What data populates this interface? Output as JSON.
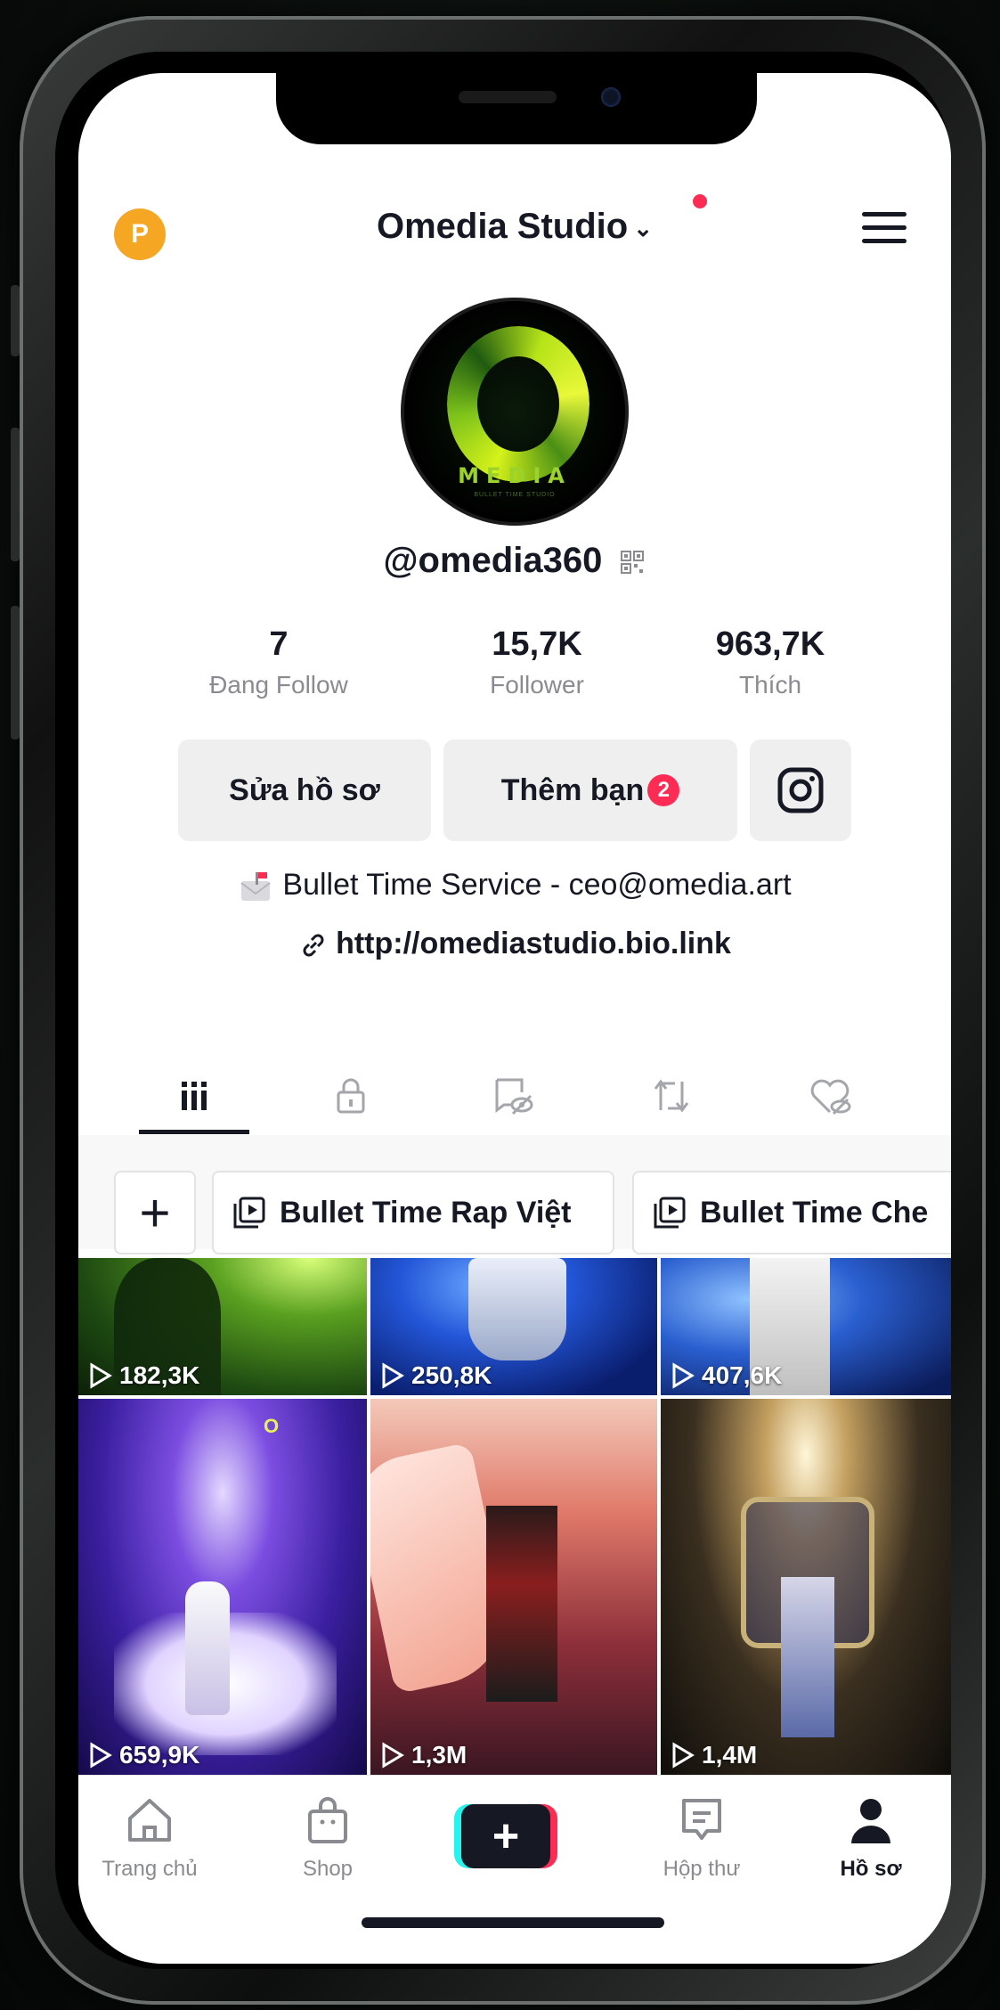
{
  "header": {
    "account_initial": "P",
    "account_name": "Omedia Studio",
    "dropdown_glyph": "⌄"
  },
  "profile": {
    "avatar_word": "MEDIA",
    "avatar_tagline": "BULLET TIME STUDIO",
    "username": "@omedia360",
    "stats": [
      {
        "value": "7",
        "label": "Đang Follow"
      },
      {
        "value": "15,7K",
        "label": "Follower"
      },
      {
        "value": "963,7K",
        "label": "Thích"
      }
    ],
    "buttons": {
      "edit_profile": "Sửa hồ sơ",
      "add_friends": "Thêm bạn",
      "add_friends_badge": "2"
    },
    "bio": "Bullet Time Service - ceo@omedia.art",
    "link": "http://omediastudio.bio.link"
  },
  "tabs": [
    "grid",
    "private",
    "reposts-hidden",
    "reposts",
    "liked-hidden"
  ],
  "playlists": {
    "add_glyph": "+",
    "items": [
      {
        "label": "Bullet Time Rap Việt"
      },
      {
        "label": "Bullet Time Che"
      }
    ]
  },
  "videos": [
    {
      "views": "182,3K"
    },
    {
      "views": "250,8K"
    },
    {
      "views": "407,6K"
    },
    {
      "views": "659,9K"
    },
    {
      "views": "1,3M"
    },
    {
      "views": "1,4M"
    }
  ],
  "bottom_nav": [
    {
      "label": "Trang chủ",
      "icon": "home-icon"
    },
    {
      "label": "Shop",
      "icon": "shop-icon"
    },
    {
      "label": "",
      "icon": "plus-icon"
    },
    {
      "label": "Hộp thư",
      "icon": "inbox-icon"
    },
    {
      "label": "Hồ sơ",
      "icon": "profile-icon"
    }
  ],
  "colors": {
    "accent_red": "#fe2c55",
    "accent_cyan": "#25f4ee",
    "badge_orange": "#f5a623",
    "text_primary": "#161823",
    "text_secondary": "#8a8b91"
  }
}
